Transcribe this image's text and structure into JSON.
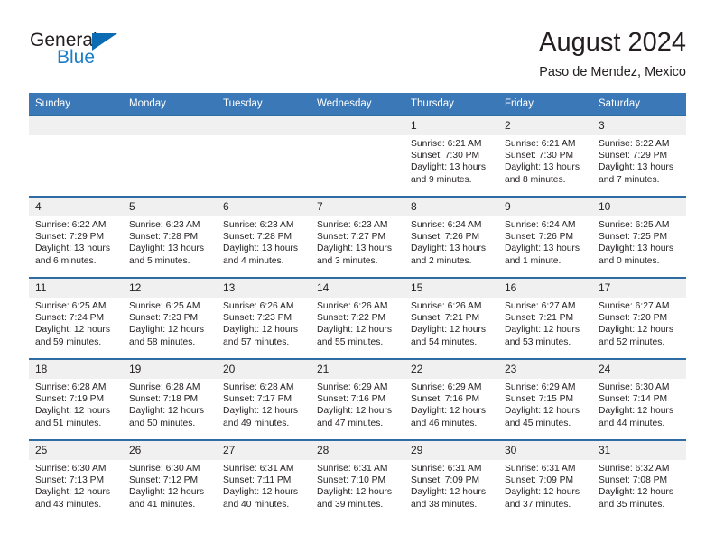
{
  "brand": {
    "word_one": "General",
    "word_two": "Blue",
    "triangle_icon": "triangle-icon",
    "color_dark": "#231f20",
    "color_blue": "#1a7ec8"
  },
  "header": {
    "title": "August 2024",
    "location": "Paso de Mendez, Mexico"
  },
  "theme": {
    "header_blue": "#3b78b8",
    "row_rule_blue": "#2e6da4",
    "daynum_band": "#f0f0f0"
  },
  "calendar": {
    "weekday_headers": [
      "Sunday",
      "Monday",
      "Tuesday",
      "Wednesday",
      "Thursday",
      "Friday",
      "Saturday"
    ],
    "weeks": [
      [
        {
          "day": "",
          "blank": true
        },
        {
          "day": "",
          "blank": true
        },
        {
          "day": "",
          "blank": true
        },
        {
          "day": "",
          "blank": true
        },
        {
          "day": "1",
          "sunrise": "Sunrise: 6:21 AM",
          "sunset": "Sunset: 7:30 PM",
          "daylight": "Daylight: 13 hours and 9 minutes."
        },
        {
          "day": "2",
          "sunrise": "Sunrise: 6:21 AM",
          "sunset": "Sunset: 7:30 PM",
          "daylight": "Daylight: 13 hours and 8 minutes."
        },
        {
          "day": "3",
          "sunrise": "Sunrise: 6:22 AM",
          "sunset": "Sunset: 7:29 PM",
          "daylight": "Daylight: 13 hours and 7 minutes."
        }
      ],
      [
        {
          "day": "4",
          "sunrise": "Sunrise: 6:22 AM",
          "sunset": "Sunset: 7:29 PM",
          "daylight": "Daylight: 13 hours and 6 minutes."
        },
        {
          "day": "5",
          "sunrise": "Sunrise: 6:23 AM",
          "sunset": "Sunset: 7:28 PM",
          "daylight": "Daylight: 13 hours and 5 minutes."
        },
        {
          "day": "6",
          "sunrise": "Sunrise: 6:23 AM",
          "sunset": "Sunset: 7:28 PM",
          "daylight": "Daylight: 13 hours and 4 minutes."
        },
        {
          "day": "7",
          "sunrise": "Sunrise: 6:23 AM",
          "sunset": "Sunset: 7:27 PM",
          "daylight": "Daylight: 13 hours and 3 minutes."
        },
        {
          "day": "8",
          "sunrise": "Sunrise: 6:24 AM",
          "sunset": "Sunset: 7:26 PM",
          "daylight": "Daylight: 13 hours and 2 minutes."
        },
        {
          "day": "9",
          "sunrise": "Sunrise: 6:24 AM",
          "sunset": "Sunset: 7:26 PM",
          "daylight": "Daylight: 13 hours and 1 minute."
        },
        {
          "day": "10",
          "sunrise": "Sunrise: 6:25 AM",
          "sunset": "Sunset: 7:25 PM",
          "daylight": "Daylight: 13 hours and 0 minutes."
        }
      ],
      [
        {
          "day": "11",
          "sunrise": "Sunrise: 6:25 AM",
          "sunset": "Sunset: 7:24 PM",
          "daylight": "Daylight: 12 hours and 59 minutes."
        },
        {
          "day": "12",
          "sunrise": "Sunrise: 6:25 AM",
          "sunset": "Sunset: 7:23 PM",
          "daylight": "Daylight: 12 hours and 58 minutes."
        },
        {
          "day": "13",
          "sunrise": "Sunrise: 6:26 AM",
          "sunset": "Sunset: 7:23 PM",
          "daylight": "Daylight: 12 hours and 57 minutes."
        },
        {
          "day": "14",
          "sunrise": "Sunrise: 6:26 AM",
          "sunset": "Sunset: 7:22 PM",
          "daylight": "Daylight: 12 hours and 55 minutes."
        },
        {
          "day": "15",
          "sunrise": "Sunrise: 6:26 AM",
          "sunset": "Sunset: 7:21 PM",
          "daylight": "Daylight: 12 hours and 54 minutes."
        },
        {
          "day": "16",
          "sunrise": "Sunrise: 6:27 AM",
          "sunset": "Sunset: 7:21 PM",
          "daylight": "Daylight: 12 hours and 53 minutes."
        },
        {
          "day": "17",
          "sunrise": "Sunrise: 6:27 AM",
          "sunset": "Sunset: 7:20 PM",
          "daylight": "Daylight: 12 hours and 52 minutes."
        }
      ],
      [
        {
          "day": "18",
          "sunrise": "Sunrise: 6:28 AM",
          "sunset": "Sunset: 7:19 PM",
          "daylight": "Daylight: 12 hours and 51 minutes."
        },
        {
          "day": "19",
          "sunrise": "Sunrise: 6:28 AM",
          "sunset": "Sunset: 7:18 PM",
          "daylight": "Daylight: 12 hours and 50 minutes."
        },
        {
          "day": "20",
          "sunrise": "Sunrise: 6:28 AM",
          "sunset": "Sunset: 7:17 PM",
          "daylight": "Daylight: 12 hours and 49 minutes."
        },
        {
          "day": "21",
          "sunrise": "Sunrise: 6:29 AM",
          "sunset": "Sunset: 7:16 PM",
          "daylight": "Daylight: 12 hours and 47 minutes."
        },
        {
          "day": "22",
          "sunrise": "Sunrise: 6:29 AM",
          "sunset": "Sunset: 7:16 PM",
          "daylight": "Daylight: 12 hours and 46 minutes."
        },
        {
          "day": "23",
          "sunrise": "Sunrise: 6:29 AM",
          "sunset": "Sunset: 7:15 PM",
          "daylight": "Daylight: 12 hours and 45 minutes."
        },
        {
          "day": "24",
          "sunrise": "Sunrise: 6:30 AM",
          "sunset": "Sunset: 7:14 PM",
          "daylight": "Daylight: 12 hours and 44 minutes."
        }
      ],
      [
        {
          "day": "25",
          "sunrise": "Sunrise: 6:30 AM",
          "sunset": "Sunset: 7:13 PM",
          "daylight": "Daylight: 12 hours and 43 minutes."
        },
        {
          "day": "26",
          "sunrise": "Sunrise: 6:30 AM",
          "sunset": "Sunset: 7:12 PM",
          "daylight": "Daylight: 12 hours and 41 minutes."
        },
        {
          "day": "27",
          "sunrise": "Sunrise: 6:31 AM",
          "sunset": "Sunset: 7:11 PM",
          "daylight": "Daylight: 12 hours and 40 minutes."
        },
        {
          "day": "28",
          "sunrise": "Sunrise: 6:31 AM",
          "sunset": "Sunset: 7:10 PM",
          "daylight": "Daylight: 12 hours and 39 minutes."
        },
        {
          "day": "29",
          "sunrise": "Sunrise: 6:31 AM",
          "sunset": "Sunset: 7:09 PM",
          "daylight": "Daylight: 12 hours and 38 minutes."
        },
        {
          "day": "30",
          "sunrise": "Sunrise: 6:31 AM",
          "sunset": "Sunset: 7:09 PM",
          "daylight": "Daylight: 12 hours and 37 minutes."
        },
        {
          "day": "31",
          "sunrise": "Sunrise: 6:32 AM",
          "sunset": "Sunset: 7:08 PM",
          "daylight": "Daylight: 12 hours and 35 minutes."
        }
      ]
    ]
  }
}
